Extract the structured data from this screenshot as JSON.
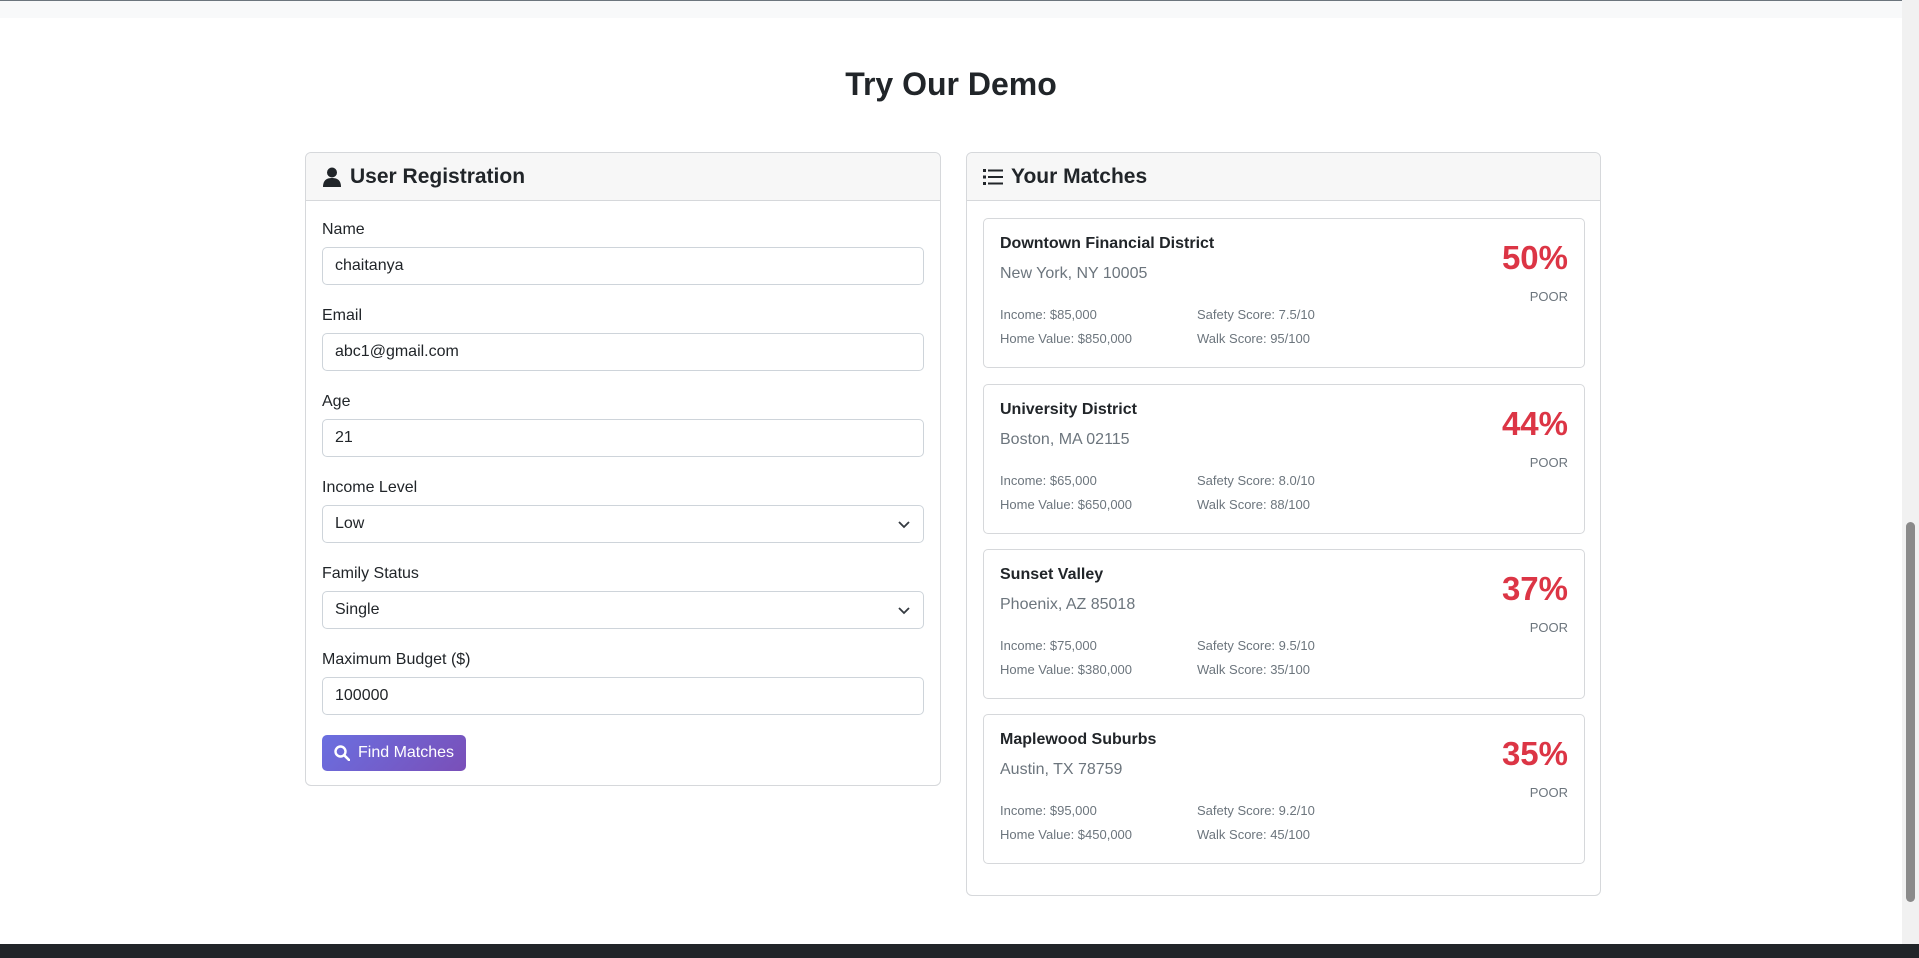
{
  "section": {
    "title": "Try Our Demo"
  },
  "registration": {
    "title": "User Registration",
    "icon": "user-icon",
    "fields": {
      "name": {
        "label": "Name",
        "value": "chaitanya"
      },
      "email": {
        "label": "Email",
        "value": "abc1@gmail.com"
      },
      "age": {
        "label": "Age",
        "value": "21"
      },
      "income": {
        "label": "Income Level",
        "value": "Low"
      },
      "family": {
        "label": "Family Status",
        "value": "Single"
      },
      "budget": {
        "label": "Maximum Budget ($)",
        "value": "100000"
      }
    },
    "button": {
      "label": "Find Matches",
      "icon": "search-icon"
    }
  },
  "matches": {
    "title": "Your Matches",
    "icon": "list-icon",
    "items": [
      {
        "name": "Downtown Financial District",
        "location": "New York, NY 10005",
        "score": "50%",
        "rating": "POOR",
        "income": "Income: $85,000",
        "home_value": "Home Value: $850,000",
        "safety": "Safety Score: 7.5/10",
        "walk": "Walk Score: 95/100"
      },
      {
        "name": "University District",
        "location": "Boston, MA 02115",
        "score": "44%",
        "rating": "POOR",
        "income": "Income: $65,000",
        "home_value": "Home Value: $650,000",
        "safety": "Safety Score: 8.0/10",
        "walk": "Walk Score: 88/100"
      },
      {
        "name": "Sunset Valley",
        "location": "Phoenix, AZ 85018",
        "score": "37%",
        "rating": "POOR",
        "income": "Income: $75,000",
        "home_value": "Home Value: $380,000",
        "safety": "Safety Score: 9.5/10",
        "walk": "Walk Score: 35/100"
      },
      {
        "name": "Maplewood Suburbs",
        "location": "Austin, TX 78759",
        "score": "35%",
        "rating": "POOR",
        "income": "Income: $95,000",
        "home_value": "Home Value: $450,000",
        "safety": "Safety Score: 9.2/10",
        "walk": "Walk Score: 45/100"
      }
    ]
  },
  "colors": {
    "score": "#dc3545",
    "button_start": "#6a6fe0",
    "button_end": "#7a4fb8",
    "footer": "#212529"
  }
}
